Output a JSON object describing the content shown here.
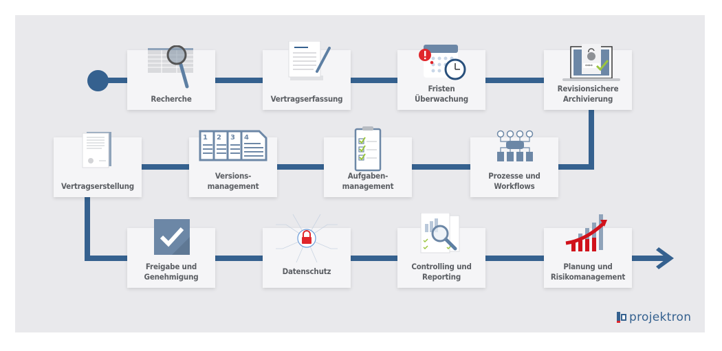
{
  "steps": [
    {
      "label": "Recherche",
      "icon": "magnifier-table-icon"
    },
    {
      "label": "Vertragserfassung",
      "icon": "document-pen-icon"
    },
    {
      "label": "Fristen\nÜberwachung",
      "icon": "calendar-clock-icon"
    },
    {
      "label": "Revisionsichere\nArchivierung",
      "icon": "laptop-lock-icon"
    },
    {
      "label": "Prozesse und\nWorkflows",
      "icon": "workflow-icon"
    },
    {
      "label": "Aufgaben-\nmanagement",
      "icon": "clipboard-checklist-icon"
    },
    {
      "label": "Versions-\nmanagement",
      "icon": "versioned-documents-icon"
    },
    {
      "label": "Vertragserstellung",
      "icon": "contract-document-icon"
    },
    {
      "label": "Freigabe und\nGenehmigung",
      "icon": "checkmark-icon"
    },
    {
      "label": "Datenschutz",
      "icon": "padlock-circuit-icon"
    },
    {
      "label": "Controlling und\nReporting",
      "icon": "report-magnifier-icon"
    },
    {
      "label": "Planung und\nRisikomanagement",
      "icon": "growth-chart-icon"
    }
  ],
  "version_numbers": [
    "1",
    "2",
    "3",
    "4"
  ],
  "logo": {
    "text": "projektron"
  },
  "colors": {
    "path": "#35618f",
    "background": "#e9e9ec",
    "card": "#f5f5f7",
    "text": "#5b5e63",
    "alert_red": "#e0262b",
    "check_green": "#9bc53d"
  }
}
